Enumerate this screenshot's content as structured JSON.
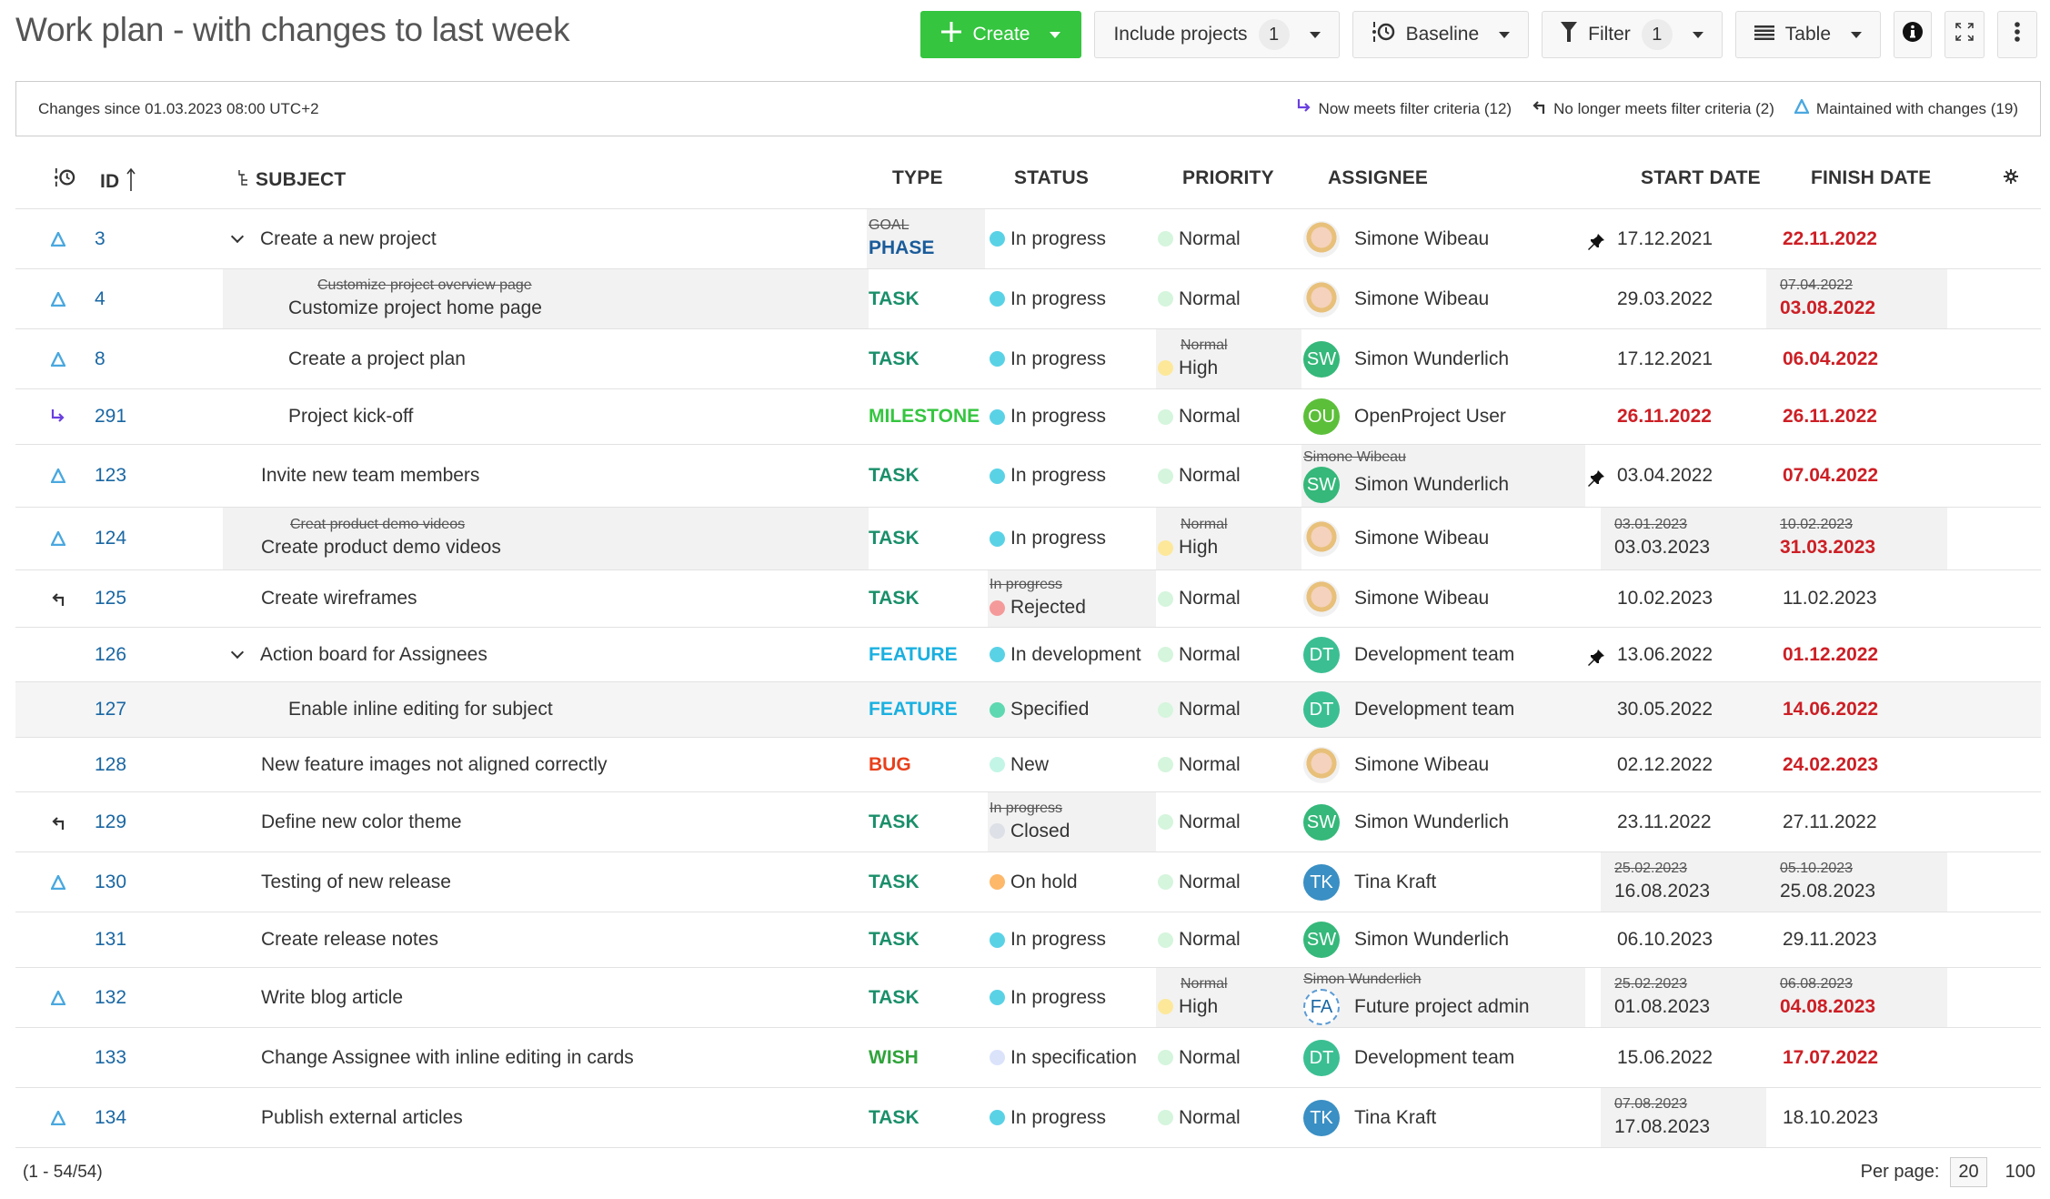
{
  "page": {
    "title": "Work plan - with changes to last week"
  },
  "toolbar": {
    "create_label": "Create",
    "include_projects_label": "Include projects",
    "include_projects_count": "1",
    "baseline_label": "Baseline",
    "filter_label": "Filter",
    "filter_count": "1",
    "view_label": "Table"
  },
  "changes": {
    "since_text": "Changes since 01.03.2023 08:00 UTC+2",
    "legend": {
      "now_meets": "Now meets filter criteria (12)",
      "no_longer": "No longer meets filter criteria (2)",
      "maintained": "Maintained with changes (19)"
    }
  },
  "colors": {
    "create": "#35c53f",
    "id_link": "#1a67a3",
    "maintained": "#4aa8df",
    "now_meets": "#6a3fe0",
    "no_longer": "#333333",
    "overdue": "#cc1f25",
    "changed_bg": "#f2f2f2"
  },
  "columns": {
    "id": "ID",
    "subject": "SUBJECT",
    "type": "TYPE",
    "status": "STATUS",
    "priority": "PRIORITY",
    "assignee": "ASSIGNEE",
    "start": "START DATE",
    "finish": "FINISH DATE"
  },
  "rows": [
    {
      "change": "maintained",
      "id": "3",
      "indent": 0,
      "collapsible": true,
      "subject": "Create a new project",
      "subject_old": null,
      "type": "PHASE",
      "type_color": "#1a5b9a",
      "type_old": "GOAL",
      "status": "In progress",
      "status_color": "#5ad2e6",
      "status_old": null,
      "priority": "Normal",
      "priority_color": "#d5f5dd",
      "priority_old": null,
      "assignee": "Simone Wibeau",
      "avatar": "photo",
      "assignee_old": null,
      "pinned": true,
      "start": "17.12.2021",
      "start_red": false,
      "start_old": null,
      "finish": "22.11.2022",
      "finish_red": true,
      "finish_old": null,
      "hl": false
    },
    {
      "change": "maintained",
      "id": "4",
      "indent": 1,
      "collapsible": false,
      "subject": "Customize project home page",
      "subject_old": "Customize project overview page",
      "type": "TASK",
      "type_color": "#1a8f6a",
      "type_old": null,
      "status": "In progress",
      "status_color": "#5ad2e6",
      "status_old": null,
      "priority": "Normal",
      "priority_color": "#d5f5dd",
      "priority_old": null,
      "assignee": "Simone Wibeau",
      "avatar": "photo",
      "assignee_old": null,
      "pinned": false,
      "start": "29.03.2022",
      "start_red": false,
      "start_old": null,
      "finish": "03.08.2022",
      "finish_red": true,
      "finish_old": "07.04.2022",
      "hl": false
    },
    {
      "change": "maintained",
      "id": "8",
      "indent": 1,
      "collapsible": false,
      "subject": "Create a project plan",
      "subject_old": null,
      "type": "TASK",
      "type_color": "#1a8f6a",
      "type_old": null,
      "status": "In progress",
      "status_color": "#5ad2e6",
      "status_old": null,
      "priority": "High",
      "priority_color": "#fde89a",
      "priority_old": "Normal",
      "assignee": "Simon Wunderlich",
      "avatar": "SW",
      "avatar_color": "#35b87a",
      "assignee_old": null,
      "pinned": false,
      "start": "17.12.2021",
      "start_red": false,
      "start_old": null,
      "finish": "06.04.2022",
      "finish_red": true,
      "finish_old": null,
      "hl": false
    },
    {
      "change": "now_meets",
      "id": "291",
      "indent": 1,
      "collapsible": false,
      "subject": "Project kick-off",
      "subject_old": null,
      "type": "MILESTONE",
      "type_color": "#35c53f",
      "type_old": null,
      "status": "In progress",
      "status_color": "#5ad2e6",
      "status_old": null,
      "priority": "Normal",
      "priority_color": "#d5f5dd",
      "priority_old": null,
      "assignee": "OpenProject User",
      "avatar": "OU",
      "avatar_color": "#5cbf3a",
      "assignee_old": null,
      "pinned": false,
      "start": "26.11.2022",
      "start_red": true,
      "start_old": null,
      "finish": "26.11.2022",
      "finish_red": true,
      "finish_old": null,
      "hl": false
    },
    {
      "change": "maintained",
      "id": "123",
      "indent": 0,
      "collapsible": false,
      "subject": "Invite new team members",
      "subject_old": null,
      "type": "TASK",
      "type_color": "#1a8f6a",
      "type_old": null,
      "status": "In progress",
      "status_color": "#5ad2e6",
      "status_old": null,
      "priority": "Normal",
      "priority_color": "#d5f5dd",
      "priority_old": null,
      "assignee": "Simon Wunderlich",
      "avatar": "SW",
      "avatar_color": "#35b87a",
      "assignee_old": "Simone Wibeau",
      "pinned": true,
      "start": "03.04.2022",
      "start_red": false,
      "start_old": null,
      "finish": "07.04.2022",
      "finish_red": true,
      "finish_old": null,
      "hl": false
    },
    {
      "change": "maintained",
      "id": "124",
      "indent": 0,
      "collapsible": false,
      "subject": "Create product demo videos",
      "subject_old": "Creat product demo videos",
      "type": "TASK",
      "type_color": "#1a8f6a",
      "type_old": null,
      "status": "In progress",
      "status_color": "#5ad2e6",
      "status_old": null,
      "priority": "High",
      "priority_color": "#fde89a",
      "priority_old": "Normal",
      "assignee": "Simone Wibeau",
      "avatar": "photo",
      "assignee_old": null,
      "pinned": false,
      "start": "03.03.2023",
      "start_red": false,
      "start_old": "03.01.2023",
      "finish": "31.03.2023",
      "finish_red": true,
      "finish_old": "10.02.2023",
      "hl": false
    },
    {
      "change": "no_longer",
      "id": "125",
      "indent": 0,
      "collapsible": false,
      "subject": "Create wireframes",
      "subject_old": null,
      "type": "TASK",
      "type_color": "#1a8f6a",
      "type_old": null,
      "status": "Rejected",
      "status_color": "#f59a9a",
      "status_old": "In progress",
      "priority": "Normal",
      "priority_color": "#d5f5dd",
      "priority_old": null,
      "assignee": "Simone Wibeau",
      "avatar": "photo",
      "assignee_old": null,
      "pinned": false,
      "start": "10.02.2023",
      "start_red": false,
      "start_old": null,
      "finish": "11.02.2023",
      "finish_red": false,
      "finish_old": null,
      "hl": false
    },
    {
      "change": null,
      "id": "126",
      "indent": 0,
      "collapsible": true,
      "subject": "Action board for Assignees",
      "subject_old": null,
      "type": "FEATURE",
      "type_color": "#1ab0e0",
      "type_old": null,
      "status": "In development",
      "status_color": "#5ad2e6",
      "status_old": null,
      "priority": "Normal",
      "priority_color": "#d5f5dd",
      "priority_old": null,
      "assignee": "Development team",
      "avatar": "DT",
      "avatar_color": "#3bbf92",
      "assignee_old": null,
      "pinned": true,
      "start": "13.06.2022",
      "start_red": false,
      "start_old": null,
      "finish": "01.12.2022",
      "finish_red": true,
      "finish_old": null,
      "hl": false
    },
    {
      "change": null,
      "id": "127",
      "indent": 1,
      "collapsible": false,
      "subject": "Enable inline editing for subject",
      "subject_old": null,
      "type": "FEATURE",
      "type_color": "#1ab0e0",
      "type_old": null,
      "status": "Specified",
      "status_color": "#5ed8b0",
      "status_old": null,
      "priority": "Normal",
      "priority_color": "#d5f5dd",
      "priority_old": null,
      "assignee": "Development team",
      "avatar": "DT",
      "avatar_color": "#3bbf92",
      "assignee_old": null,
      "pinned": false,
      "start": "30.05.2022",
      "start_red": false,
      "start_old": null,
      "finish": "14.06.2022",
      "finish_red": true,
      "finish_old": null,
      "hl": true
    },
    {
      "change": null,
      "id": "128",
      "indent": 0,
      "collapsible": false,
      "subject": "New feature images not aligned correctly",
      "subject_old": null,
      "type": "BUG",
      "type_color": "#e8401c",
      "type_old": null,
      "status": "New",
      "status_color": "#c3f5e6",
      "status_old": null,
      "priority": "Normal",
      "priority_color": "#d5f5dd",
      "priority_old": null,
      "assignee": "Simone Wibeau",
      "avatar": "photo",
      "assignee_old": null,
      "pinned": false,
      "start": "02.12.2022",
      "start_red": false,
      "start_old": null,
      "finish": "24.02.2023",
      "finish_red": true,
      "finish_old": null,
      "hl": false
    },
    {
      "change": "no_longer",
      "id": "129",
      "indent": 0,
      "collapsible": false,
      "subject": "Define new color theme",
      "subject_old": null,
      "type": "TASK",
      "type_color": "#1a8f6a",
      "type_old": null,
      "status": "Closed",
      "status_color": "#dde0e6",
      "status_old": "In progress",
      "priority": "Normal",
      "priority_color": "#d5f5dd",
      "priority_old": null,
      "assignee": "Simon Wunderlich",
      "avatar": "SW",
      "avatar_color": "#35b87a",
      "assignee_old": null,
      "pinned": false,
      "start": "23.11.2022",
      "start_red": false,
      "start_old": null,
      "finish": "27.11.2022",
      "finish_red": false,
      "finish_old": null,
      "hl": false
    },
    {
      "change": "maintained",
      "id": "130",
      "indent": 0,
      "collapsible": false,
      "subject": "Testing of new release",
      "subject_old": null,
      "type": "TASK",
      "type_color": "#1a8f6a",
      "type_old": null,
      "status": "On hold",
      "status_color": "#fdb86a",
      "status_old": null,
      "priority": "Normal",
      "priority_color": "#d5f5dd",
      "priority_old": null,
      "assignee": "Tina Kraft",
      "avatar": "TK",
      "avatar_color": "#3a8fc4",
      "assignee_old": null,
      "pinned": false,
      "start": "16.08.2023",
      "start_red": false,
      "start_old": "25.02.2023",
      "finish": "25.08.2023",
      "finish_red": false,
      "finish_old": "05.10.2023",
      "hl": false
    },
    {
      "change": null,
      "id": "131",
      "indent": 0,
      "collapsible": false,
      "subject": "Create release notes",
      "subject_old": null,
      "type": "TASK",
      "type_color": "#1a8f6a",
      "type_old": null,
      "status": "In progress",
      "status_color": "#5ad2e6",
      "status_old": null,
      "priority": "Normal",
      "priority_color": "#d5f5dd",
      "priority_old": null,
      "assignee": "Simon Wunderlich",
      "avatar": "SW",
      "avatar_color": "#35b87a",
      "assignee_old": null,
      "pinned": false,
      "start": "06.10.2023",
      "start_red": false,
      "start_old": null,
      "finish": "29.11.2023",
      "finish_red": false,
      "finish_old": null,
      "hl": false
    },
    {
      "change": "maintained",
      "id": "132",
      "indent": 0,
      "collapsible": false,
      "subject": "Write blog article",
      "subject_old": null,
      "type": "TASK",
      "type_color": "#1a8f6a",
      "type_old": null,
      "status": "In progress",
      "status_color": "#5ad2e6",
      "status_old": null,
      "priority": "High",
      "priority_color": "#fde89a",
      "priority_old": "Normal",
      "assignee": "Future project admin",
      "avatar": "FA",
      "avatar_color": "dashed",
      "assignee_old": "Simon Wunderlich",
      "pinned": false,
      "start": "01.08.2023",
      "start_red": false,
      "start_old": "25.02.2023",
      "finish": "04.08.2023",
      "finish_red": true,
      "finish_old": "06.08.2023",
      "hl": false
    },
    {
      "change": null,
      "id": "133",
      "indent": 0,
      "collapsible": false,
      "subject": "Change Assignee with inline editing in cards",
      "subject_old": null,
      "type": "WISH",
      "type_color": "#2fa33a",
      "type_old": null,
      "status": "In specification",
      "status_color": "#dbe3fb",
      "status_old": null,
      "priority": "Normal",
      "priority_color": "#d5f5dd",
      "priority_old": null,
      "assignee": "Development team",
      "avatar": "DT",
      "avatar_color": "#3bbf92",
      "assignee_old": null,
      "pinned": false,
      "start": "15.06.2022",
      "start_red": false,
      "start_old": null,
      "finish": "17.07.2022",
      "finish_red": true,
      "finish_old": null,
      "hl": false
    },
    {
      "change": "maintained",
      "id": "134",
      "indent": 0,
      "collapsible": false,
      "subject": "Publish external articles",
      "subject_old": null,
      "type": "TASK",
      "type_color": "#1a8f6a",
      "type_old": null,
      "status": "In progress",
      "status_color": "#5ad2e6",
      "status_old": null,
      "priority": "Normal",
      "priority_color": "#d5f5dd",
      "priority_old": null,
      "assignee": "Tina Kraft",
      "avatar": "TK",
      "avatar_color": "#3a8fc4",
      "assignee_old": null,
      "pinned": false,
      "start": "17.08.2023",
      "start_red": false,
      "start_old": "07.08.2023",
      "finish": "18.10.2023",
      "finish_red": false,
      "finish_old": null,
      "hl": false
    }
  ],
  "footer": {
    "count": "(1 - 54/54)",
    "per_page_label": "Per page:",
    "per_page_options": [
      "20",
      "100"
    ],
    "per_page_selected": "20"
  }
}
